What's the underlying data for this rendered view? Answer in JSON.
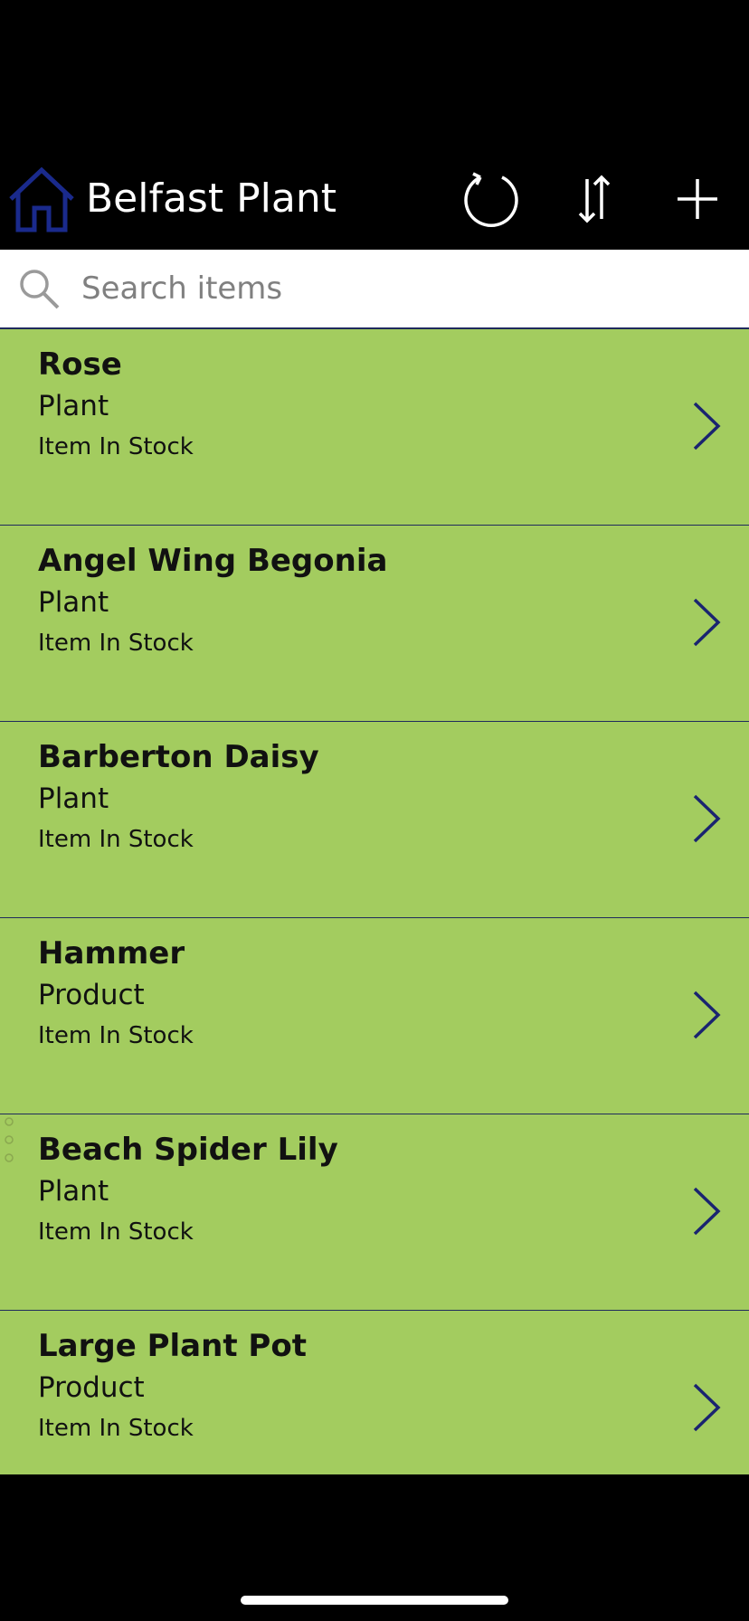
{
  "header": {
    "title": "Belfast Plant",
    "home_icon": "home-icon",
    "refresh_icon": "refresh-icon",
    "sort_icon": "sort-icon",
    "add_icon": "add-icon"
  },
  "search": {
    "placeholder": "Search items",
    "value": "",
    "icon": "search-icon"
  },
  "items": [
    {
      "title": "Rose",
      "subtitle": "Plant",
      "status": "Item In Stock"
    },
    {
      "title": "Angel Wing Begonia",
      "subtitle": "Plant",
      "status": "Item In Stock"
    },
    {
      "title": "Barberton Daisy",
      "subtitle": "Plant",
      "status": "Item In Stock"
    },
    {
      "title": "Hammer",
      "subtitle": "Product",
      "status": "Item In Stock"
    },
    {
      "title": "Beach Spider Lily",
      "subtitle": "Plant",
      "status": "Item In Stock"
    },
    {
      "title": "Large Plant Pot",
      "subtitle": "Product",
      "status": "Item In Stock"
    }
  ],
  "colors": {
    "background": "#000000",
    "list_background": "#a3cc5f",
    "accent": "#1f2a5c",
    "header_text": "#ffffff"
  }
}
